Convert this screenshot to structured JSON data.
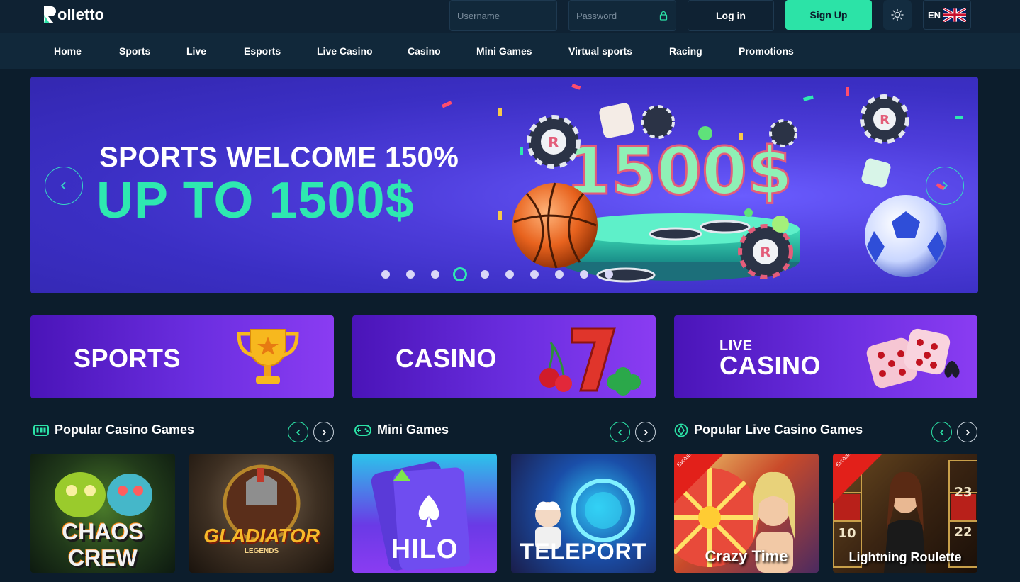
{
  "header": {
    "logo_text": "olletto",
    "username_placeholder": "Username",
    "password_placeholder": "Password",
    "login_label": "Log in",
    "signup_label": "Sign Up",
    "language_code": "EN"
  },
  "nav": {
    "items": [
      "Home",
      "Sports",
      "Live",
      "Esports",
      "Live Casino",
      "Casino",
      "Mini Games",
      "Virtual sports",
      "Racing",
      "Promotions"
    ]
  },
  "hero": {
    "line1": "SPORTS WELCOME 150%",
    "line2": "UP TO 1500$",
    "amount_art": "1500$",
    "slide_count": 10,
    "active_slide": 4
  },
  "categories": [
    {
      "label": "SPORTS",
      "icon": "trophy-icon"
    },
    {
      "label": "CASINO",
      "icon": "slot-seven-icon"
    },
    {
      "label_small": "LIVE",
      "label": "CASINO",
      "icon": "dice-icon"
    }
  ],
  "sections": [
    {
      "title": "Popular Casino Games",
      "icon": "slot-machine-icon",
      "games": [
        {
          "title": "CHAOS CREW"
        },
        {
          "title": "GLADIATOR",
          "subtitle": "LEGENDS"
        }
      ]
    },
    {
      "title": "Mini Games",
      "icon": "gamepad-icon",
      "games": [
        {
          "title": "HILO"
        },
        {
          "title": "TELEPORT"
        }
      ]
    },
    {
      "title": "Popular Live Casino Games",
      "icon": "roulette-icon",
      "games": [
        {
          "title": "Crazy Time",
          "badge": "Evolution Gaming"
        },
        {
          "title": "Lightning Roulette",
          "badge": "Evolution Gaming"
        }
      ]
    }
  ],
  "colors": {
    "background": "#0c1d2c",
    "accent": "#2ce3a7",
    "hero_purple": "#4e3ddb",
    "card_purple": "#6b2ee0"
  }
}
